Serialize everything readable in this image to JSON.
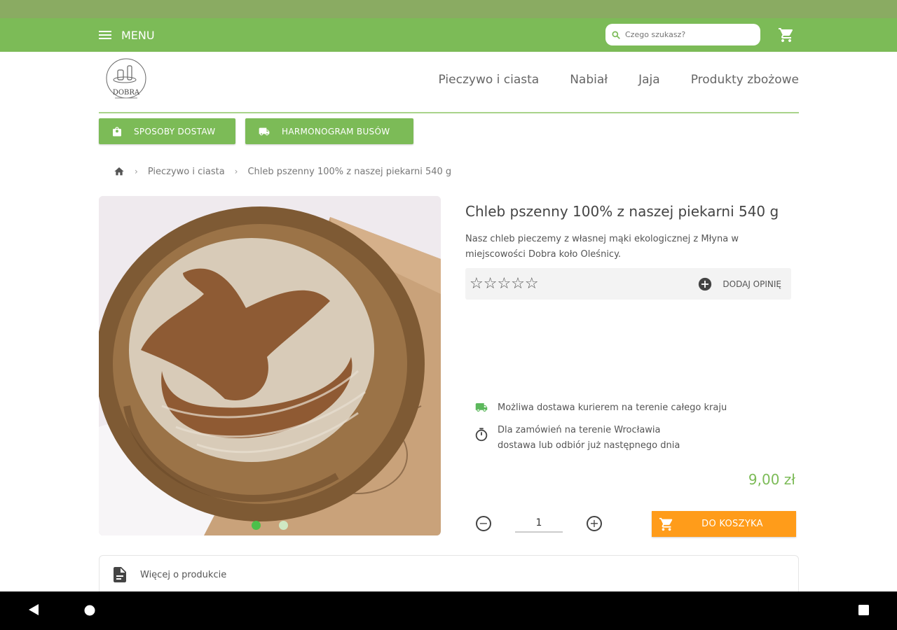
{
  "header": {
    "menu_label": "MENU",
    "search_placeholder": "Czego szukasz?"
  },
  "logo": {
    "text": "DOBRA"
  },
  "nav": {
    "items": [
      {
        "label": "Pieczywo i ciasta"
      },
      {
        "label": "Nabiał"
      },
      {
        "label": "Jaja"
      },
      {
        "label": "Produkty zbożowe"
      }
    ]
  },
  "action_buttons": {
    "delivery_label": "SPOSOBY DOSTAW",
    "bus_label": "HARMONOGRAM BUSÓW"
  },
  "breadcrumb": {
    "category": "Pieczywo i ciasta",
    "current": "Chleb pszenny 100% z naszej piekarni 540 g"
  },
  "product": {
    "title": "Chleb pszenny 100% z naszej piekarni 540 g",
    "description": "Nasz chleb pieczemy z własnej mąki ekologicznej z Młyna w miejscowości Dobra koło Oleśnicy.",
    "rating": {
      "stars": "☆☆☆☆☆",
      "value": 0,
      "max": 5
    },
    "add_review_label": "DODAJ OPINIĘ",
    "delivery_info_1": "Możliwa dostawa kurierem na terenie całego kraju",
    "delivery_info_2_line1": "Dla zamówień na terenie Wrocławia",
    "delivery_info_2_line2": "dostawa lub odbiór już następnego dnia",
    "price": "9,00 zł",
    "quantity": "1",
    "add_to_cart_label": "DO KOSZYKA"
  },
  "gallery": {
    "active_index": 0,
    "count": 2
  },
  "more_section": {
    "label": "Więcej o produkcie"
  },
  "colors": {
    "brand_green": "#7cbb57",
    "status_green": "#8aab62",
    "accent_orange": "#ff9c1a",
    "price_green": "#7cbb57"
  }
}
